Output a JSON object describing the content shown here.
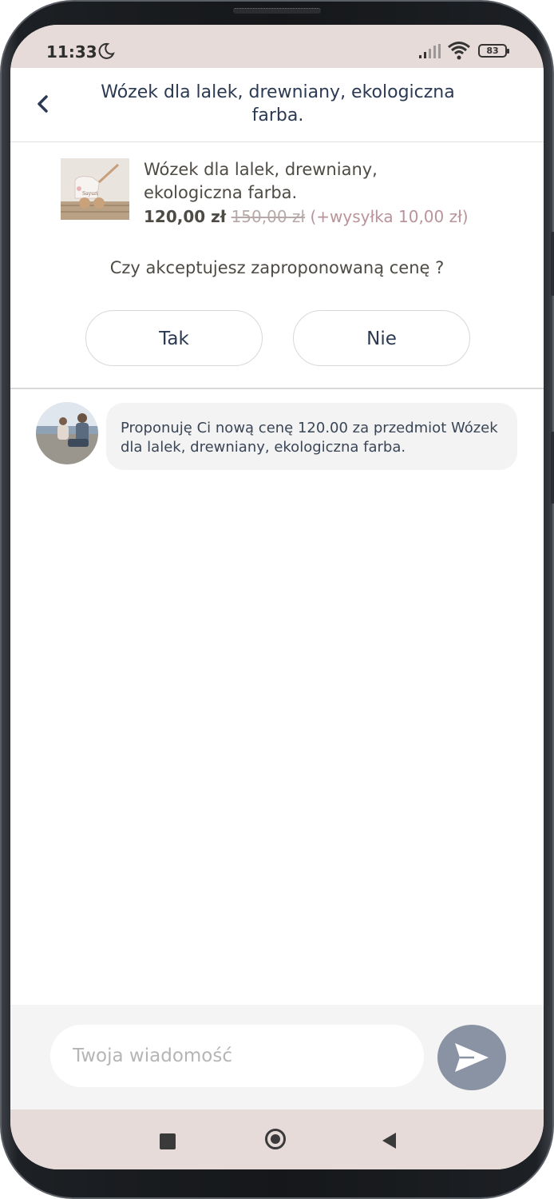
{
  "status_bar": {
    "time": "11:33",
    "battery": "83",
    "icons": [
      "moon-icon",
      "signal-icon",
      "wifi-icon",
      "battery-icon"
    ]
  },
  "header": {
    "title": "Wózek dla lalek, drewniany, ekologiczna farba.",
    "back_icon": "chevron-left-icon"
  },
  "product": {
    "title": "Wózek dla lalek, drewniany, ekologiczna farba.",
    "price_new": "120,00 zł",
    "price_old": "150,00 zł",
    "shipping": "(+wysyłka 10,00 zł)"
  },
  "offer": {
    "question": "Czy akceptujesz zaproponowaną cenę ?",
    "yes_label": "Tak",
    "no_label": "Nie"
  },
  "messages": [
    {
      "text": "Proponuję Ci nową cenę 120.00 za przedmiot Wózek dla lalek, drewniany, ekologiczna farba."
    }
  ],
  "composer": {
    "placeholder": "Twoja wiadomość",
    "send_icon": "send-icon"
  },
  "colors": {
    "accent": "#2b3a52",
    "send_button": "#8a93a4",
    "system_bar": "#e6dbd8",
    "shipping_text": "#b9939a"
  }
}
